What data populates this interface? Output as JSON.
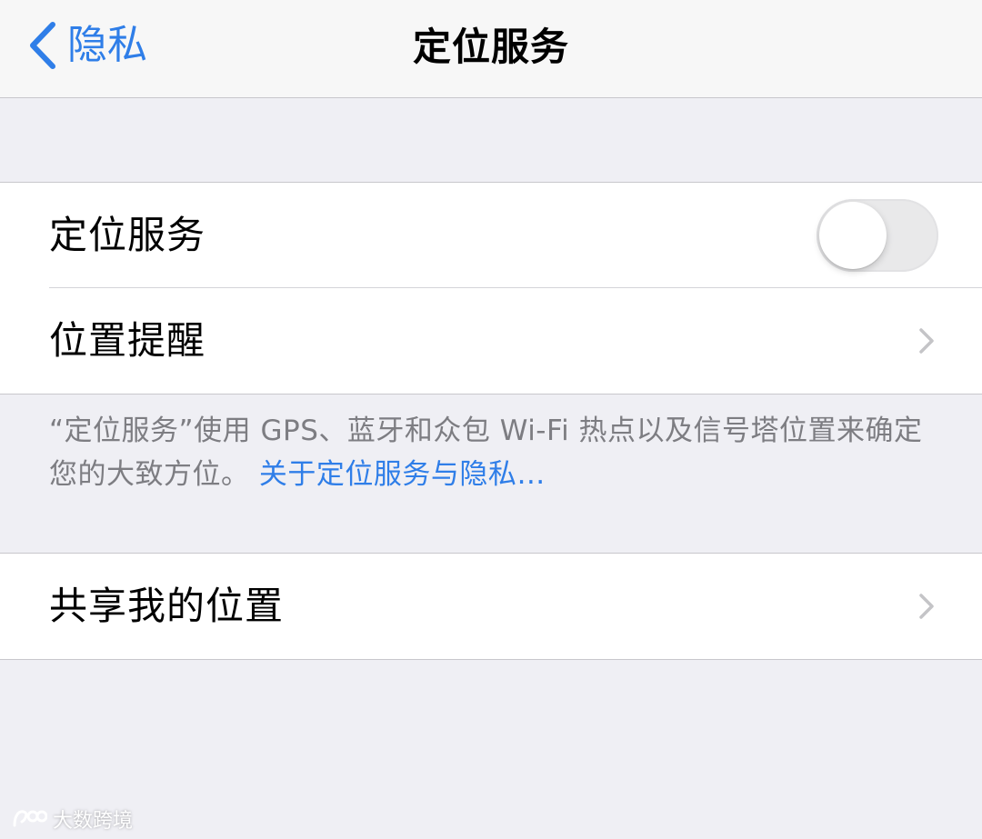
{
  "nav": {
    "back_label": "隐私",
    "title": "定位服务",
    "back_icon": "chevron-left-icon"
  },
  "main_group": {
    "location_services": {
      "label": "定位服务",
      "toggle_on": false
    },
    "location_alerts": {
      "label": "位置提醒",
      "icon": "chevron-right-icon"
    }
  },
  "footer": {
    "text": "“定位服务”使用 GPS、蓝牙和众包 Wi-Fi 热点以及信号塔位置来确定您的大致方位。 ",
    "link": "关于定位服务与隐私…"
  },
  "share_group": {
    "share_location": {
      "label": "共享我的位置",
      "icon": "chevron-right-icon"
    }
  },
  "watermark": {
    "text": "大数跨境",
    "icon": "brand-logo-icon"
  },
  "colors": {
    "accent": "#2f7ee8",
    "background": "#efeff4",
    "cell_background": "#ffffff",
    "footer_text": "#7d7d82",
    "toggle_off": "#e9e9ea"
  }
}
